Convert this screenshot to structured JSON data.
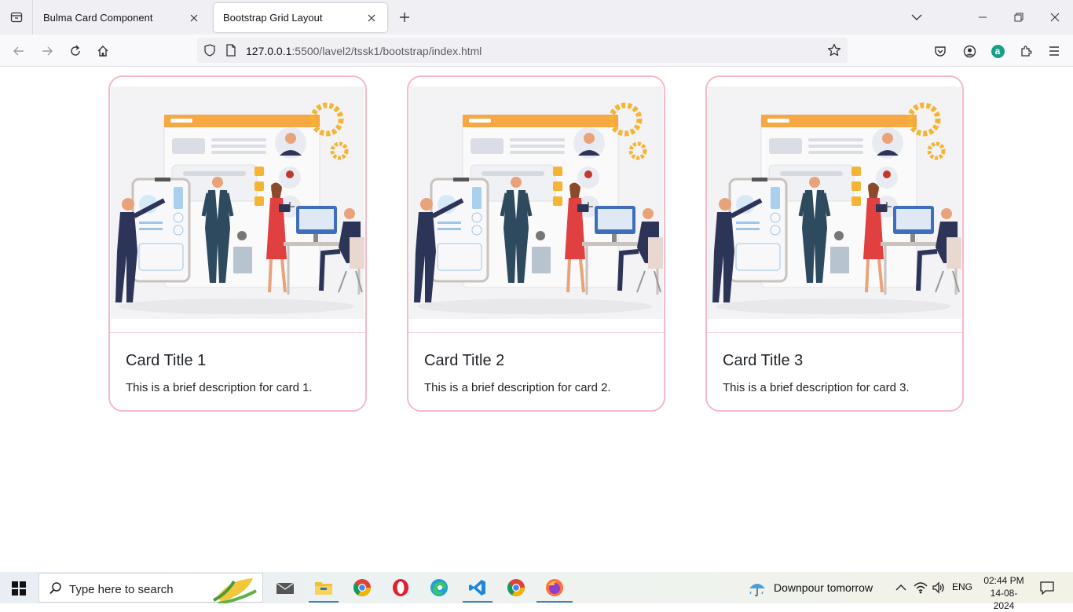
{
  "browser": {
    "tabs": [
      {
        "title": "Bulma Card Component",
        "active": false
      },
      {
        "title": "Bootstrap Grid Layout",
        "active": true
      }
    ],
    "url": {
      "host": "127.0.0.1",
      "rest": ":5500/lavel2/tssk1/bootstrap/index.html"
    },
    "extension_badge": "a"
  },
  "cards": [
    {
      "title": "Card Title 1",
      "description": "This is a brief description for card 1."
    },
    {
      "title": "Card Title 2",
      "description": "This is a brief description for card 2."
    },
    {
      "title": "Card Title 3",
      "description": "This is a brief description for card 3."
    }
  ],
  "colors": {
    "card_border": "#f7b8c8",
    "accent": "#f5a623",
    "teal": "#1a9e8a"
  },
  "taskbar": {
    "search_placeholder": "Type here to search",
    "weather": "Downpour tomorrow",
    "language": "ENG",
    "time": "02:44 PM",
    "date": "14-08-2024",
    "apps": [
      "mail-icon",
      "file-explorer-icon",
      "chrome-icon",
      "opera-icon",
      "edge-icon",
      "vscode-icon",
      "chrome-icon",
      "firefox-icon"
    ]
  }
}
